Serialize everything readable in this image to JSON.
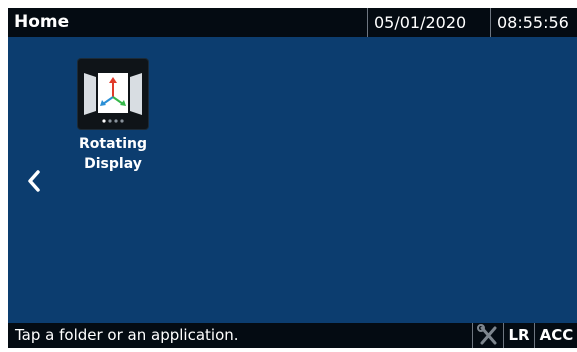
{
  "header": {
    "title": "Home",
    "date": "05/01/2020",
    "time": "08:55:56"
  },
  "nav": {
    "back_icon": "chevron-left-icon"
  },
  "apps": [
    {
      "label_line1": "Rotating",
      "label_line2": "Display",
      "icon": "rotating-display-icon"
    }
  ],
  "footer": {
    "status": "Tap a folder or an application.",
    "tool_icon": "wrench-screwdriver-icon",
    "lr_label": "LR",
    "acc_label": "ACC"
  },
  "colors": {
    "background": "#0c3d6f",
    "bar": "#040b12",
    "arrow_up": "#e03a2a",
    "arrow_left": "#2b8fd6",
    "arrow_right": "#35b84a"
  }
}
